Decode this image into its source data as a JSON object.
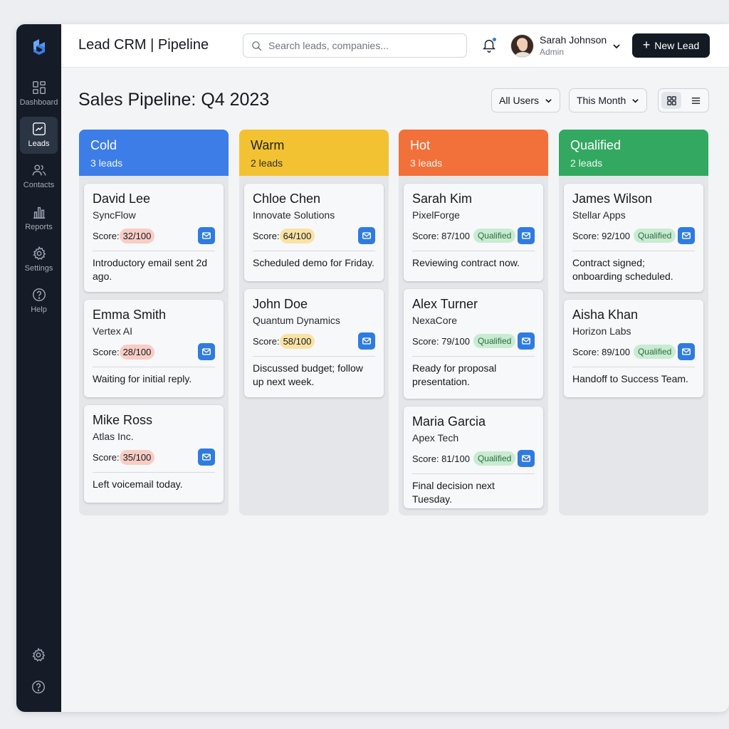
{
  "header": {
    "title": "Lead CRM | Pipeline",
    "search_placeholder": "Search leads, companies...",
    "user_name": "Sarah Johnson",
    "user_role": "Admin",
    "new_lead_label": "New Lead"
  },
  "sidebar": {
    "items": [
      {
        "label": "Dashboard",
        "icon": "dashboard-icon"
      },
      {
        "label": "Leads",
        "icon": "chart-icon",
        "active": true
      },
      {
        "label": "Contacts",
        "icon": "users-icon"
      },
      {
        "label": "Reports",
        "icon": "bar-chart-icon"
      },
      {
        "label": "Settings",
        "icon": "gear-icon"
      },
      {
        "label": "Help",
        "icon": "help-icon"
      }
    ]
  },
  "page": {
    "title": "Sales Pipeline: Q4 2023",
    "filters": [
      "All Users",
      "This Month"
    ]
  },
  "colors": {
    "cold": "#3d7de8",
    "warm": "#f3c233",
    "hot": "#f2703a",
    "qualified": "#33a860",
    "accent": "#2f7be0"
  },
  "columns": [
    {
      "name": "Cold",
      "count": "3 leads",
      "cards": [
        {
          "name": "David Lee",
          "company": "SyncFlow",
          "score_label": "Score:",
          "score": "32/100",
          "note": "Introductory email sent 2d ago."
        },
        {
          "name": "Emma Smith",
          "company": "Vertex AI",
          "score_label": "Score:",
          "score": "28/100",
          "note": "Waiting for initial reply."
        },
        {
          "name": "Mike Ross",
          "company": "Atlas Inc.",
          "score_label": "Score:",
          "score": "35/100",
          "note": "Left voicemail today."
        }
      ]
    },
    {
      "name": "Warm",
      "count": "2 leads",
      "cards": [
        {
          "name": "Chloe Chen",
          "company": "Innovate Solutions",
          "score_label": "Score:",
          "score": "64/100",
          "note": "Scheduled demo for Friday."
        },
        {
          "name": "John Doe",
          "company": "Quantum Dynamics",
          "score_label": "Score:",
          "score": "58/100",
          "note": "Discussed budget; follow up next week."
        }
      ]
    },
    {
      "name": "Hot",
      "count": "3 leads",
      "cards": [
        {
          "name": "Sarah Kim",
          "company": "PixelForge",
          "score_label": "Score: 87/100",
          "badge": "Qualified",
          "note": "Reviewing contract now."
        },
        {
          "name": "Alex Turner",
          "company": "NexaCore",
          "score_label": "Score: 79/100",
          "badge": "Qualified",
          "note": "Ready for proposal presentation."
        },
        {
          "name": "Maria Garcia",
          "company": "Apex Tech",
          "score_label": "Score: 81/100",
          "badge": "Qualified",
          "note": "Final decision next Tuesday."
        }
      ]
    },
    {
      "name": "Qualified",
      "count": "2 leads",
      "cards": [
        {
          "name": "James Wilson",
          "company": "Stellar Apps",
          "score_label": "Score: 92/100",
          "badge": "Qualified",
          "note": "Contract signed; onboarding scheduled."
        },
        {
          "name": "Aisha Khan",
          "company": "Horizon Labs",
          "score_label": "Score: 89/100",
          "badge": "Qualified",
          "note": "Handoff to Success Team."
        }
      ]
    }
  ]
}
